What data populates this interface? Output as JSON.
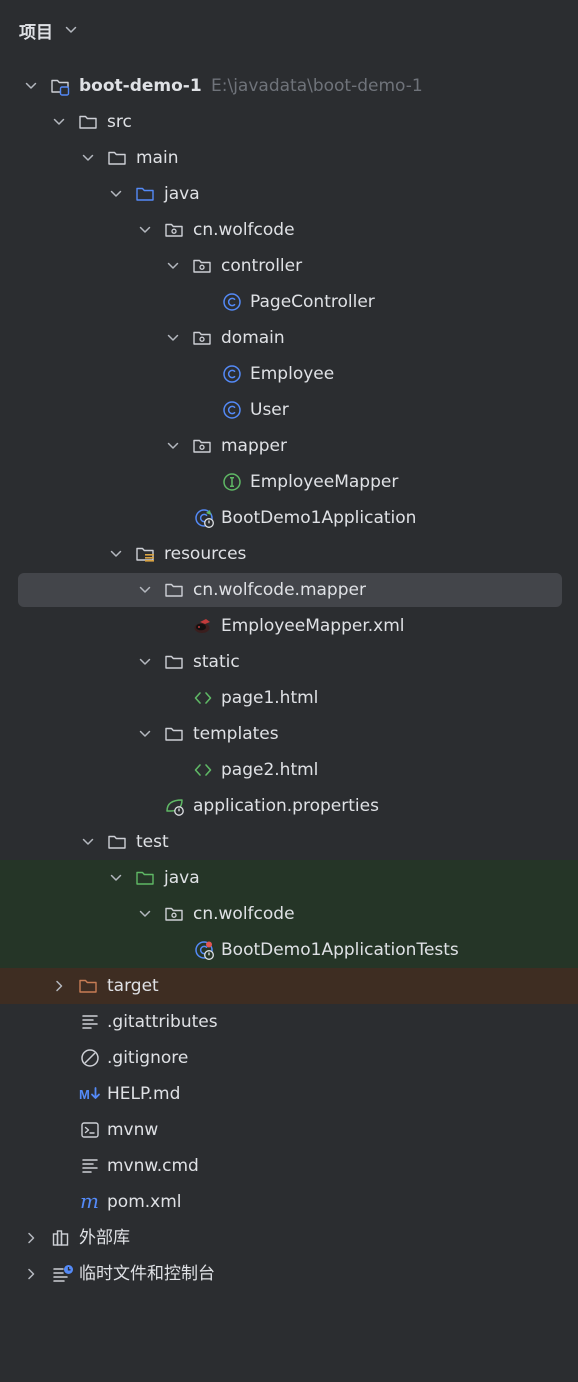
{
  "panel": {
    "title": "项目"
  },
  "tree": {
    "root": {
      "label": "boot-demo-1",
      "path": "E:\\javadata\\boot-demo-1"
    },
    "src": "src",
    "main": "main",
    "main_java": "java",
    "pkg_main": "cn.wolfcode",
    "controller": "controller",
    "page_controller": "PageController",
    "domain": "domain",
    "employee": "Employee",
    "user": "User",
    "mapper": "mapper",
    "employee_mapper": "EmployeeMapper",
    "app_class": "BootDemo1Application",
    "resources": "resources",
    "res_mapper": "cn.wolfcode.mapper",
    "mapper_xml": "EmployeeMapper.xml",
    "static": "static",
    "page1": "page1.html",
    "templates": "templates",
    "page2": "page2.html",
    "app_props": "application.properties",
    "test": "test",
    "test_java": "java",
    "pkg_test": "cn.wolfcode",
    "app_tests": "BootDemo1ApplicationTests",
    "target": "target",
    "gitattributes": ".gitattributes",
    "gitignore": ".gitignore",
    "help_md": "HELP.md",
    "mvnw": "mvnw",
    "mvnw_cmd": "mvnw.cmd",
    "pom": "pom.xml",
    "external_libs": "外部库",
    "scratches": "临时文件和控制台"
  },
  "icons": {
    "folder": "folder-icon",
    "source_folder": "source-folder-icon",
    "package": "package-icon",
    "class": "class-icon",
    "interface": "interface-icon",
    "spring_boot_class": "spring-boot-class-icon",
    "resources_folder": "resources-folder-icon",
    "mybatis_xml": "mybatis-xml-icon",
    "html": "html-icon",
    "spring_properties": "spring-properties-icon",
    "test_class": "test-class-icon",
    "text_file": "text-file-icon",
    "ignore_file": "ignore-file-icon",
    "markdown": "markdown-icon",
    "terminal": "terminal-icon",
    "maven": "maven-icon",
    "library": "library-icon",
    "scratches": "scratches-icon"
  },
  "colors": {
    "background": "#2b2d30",
    "selection": "#43454a",
    "test_row": "#253527",
    "excluded_row": "#3e2d22",
    "class_blue": "#548af7",
    "interface_green": "#5fb865",
    "excluded_orange": "#c77d55",
    "text": "#dfe1e5",
    "path_gray": "#6f737a"
  }
}
